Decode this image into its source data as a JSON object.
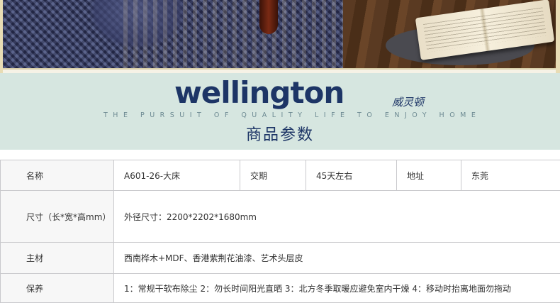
{
  "brand": {
    "logo": "wellington",
    "logo_cn": "威灵顿",
    "tagline": "THE PURSUIT OF QUALITY LIFE TO ENJOY HOME"
  },
  "section_title": "商品参数",
  "specs": {
    "name_label": "名称",
    "name_value": "A601-26-大床",
    "delivery_label": "交期",
    "delivery_value": "45天左右",
    "address_label": "地址",
    "address_value": "东莞",
    "size_label": "尺寸（长*宽*高mm）",
    "size_value": "外径尺寸：2200*2202*1680mm",
    "material_label": "主材",
    "material_value": "西南桦木+MDF、香港紫荆花油漆、艺术头层皮",
    "care_label": "保养",
    "care_value": "1：常规干软布除尘 2：勿长时间阳光直晒 3：北方冬季取暖应避免室内干燥 4：移动时抬离地面勿拖动"
  }
}
